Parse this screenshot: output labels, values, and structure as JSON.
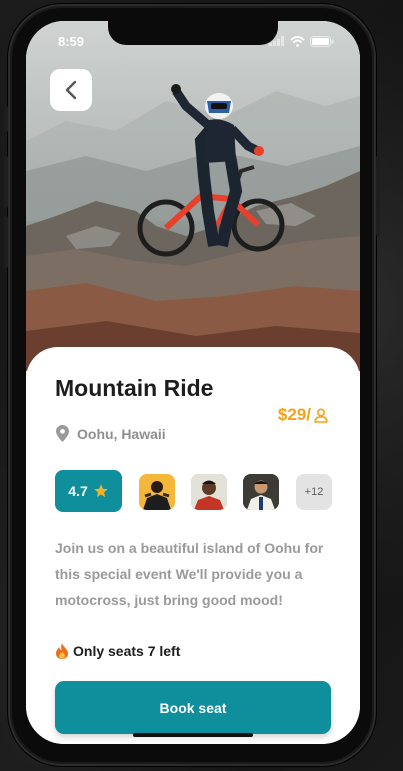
{
  "status_bar": {
    "time": "8:59",
    "icons": [
      "signal-icon",
      "wifi-icon",
      "battery-icon"
    ]
  },
  "header": {
    "back_icon": "chevron-left-icon"
  },
  "event": {
    "title": "Mountain Ride",
    "price": "$29/",
    "price_icon": "person-icon",
    "location": "Oohu, Hawaii",
    "location_icon": "map-pin-icon",
    "rating": "4.7",
    "rating_icon": "star-icon",
    "attendees_more": "+12",
    "description": "Join us on a beautiful island of Oohu for this special event We'll provide you a motocross, just bring good mood!",
    "seats": "Only seats 7 left",
    "seats_icon": "fire-icon",
    "book_label": "Book seat"
  },
  "colors": {
    "accent": "#0e8f9b",
    "price": "#f5a21b",
    "text": "#1d1d1d",
    "muted": "#9a9a9a"
  }
}
